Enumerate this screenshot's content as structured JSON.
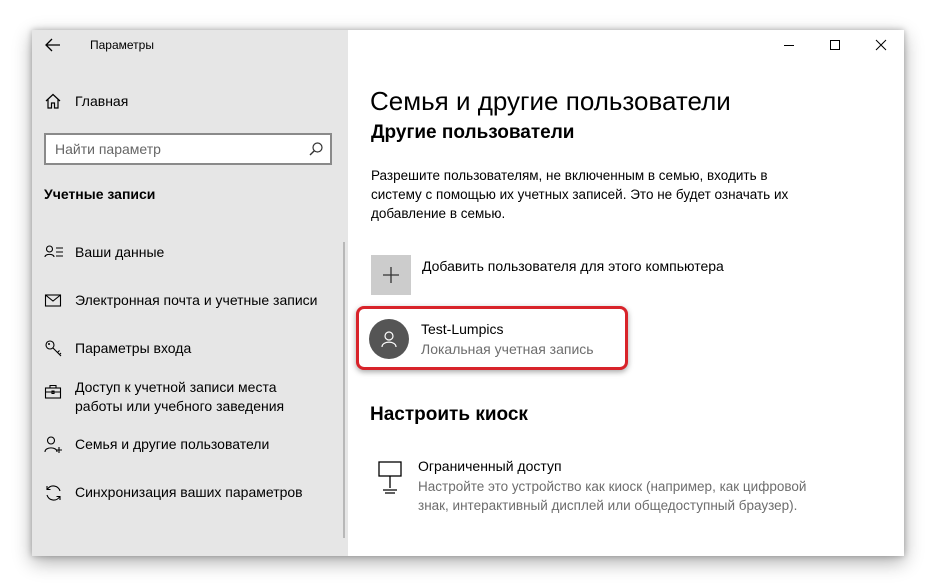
{
  "window": {
    "app_title": "Параметры"
  },
  "sidebar": {
    "home_label": "Главная",
    "search_placeholder": "Найти параметр",
    "section_title": "Учетные записи",
    "items": [
      {
        "label": "Ваши данные",
        "icon": "person-card-icon"
      },
      {
        "label": "Электронная почта и учетные записи",
        "icon": "mail-icon"
      },
      {
        "label": "Параметры входа",
        "icon": "key-icon"
      },
      {
        "label": "Доступ к учетной записи места работы или учебного заведения",
        "icon": "briefcase-icon"
      },
      {
        "label": "Семья и другие пользователи",
        "icon": "person-plus-icon"
      },
      {
        "label": "Синхронизация ваших параметров",
        "icon": "sync-icon"
      }
    ]
  },
  "content": {
    "page_title": "Семья и другие пользователи",
    "section_title": "Другие пользователи",
    "description": "Разрешите пользователям, не включенным в семью, входить в систему с помощью их учетных записей. Это не будет означать их добавление в семью.",
    "add_user_label": "Добавить пользователя для этого компьютера",
    "user": {
      "name": "Test-Lumpics",
      "account_type": "Локальная учетная запись"
    },
    "kiosk": {
      "section_title": "Настроить киоск",
      "name": "Ограниченный доступ",
      "description": "Настройте это устройство как киоск (например, как цифровой знак, интерактивный дисплей или общедоступный браузер)."
    }
  },
  "colors": {
    "sidebar_bg": "#e6e6e6",
    "highlight_border": "#d8232a",
    "avatar_bg": "#555555",
    "add_tile_bg": "#cccccc",
    "secondary_text": "#6d6d6d"
  }
}
